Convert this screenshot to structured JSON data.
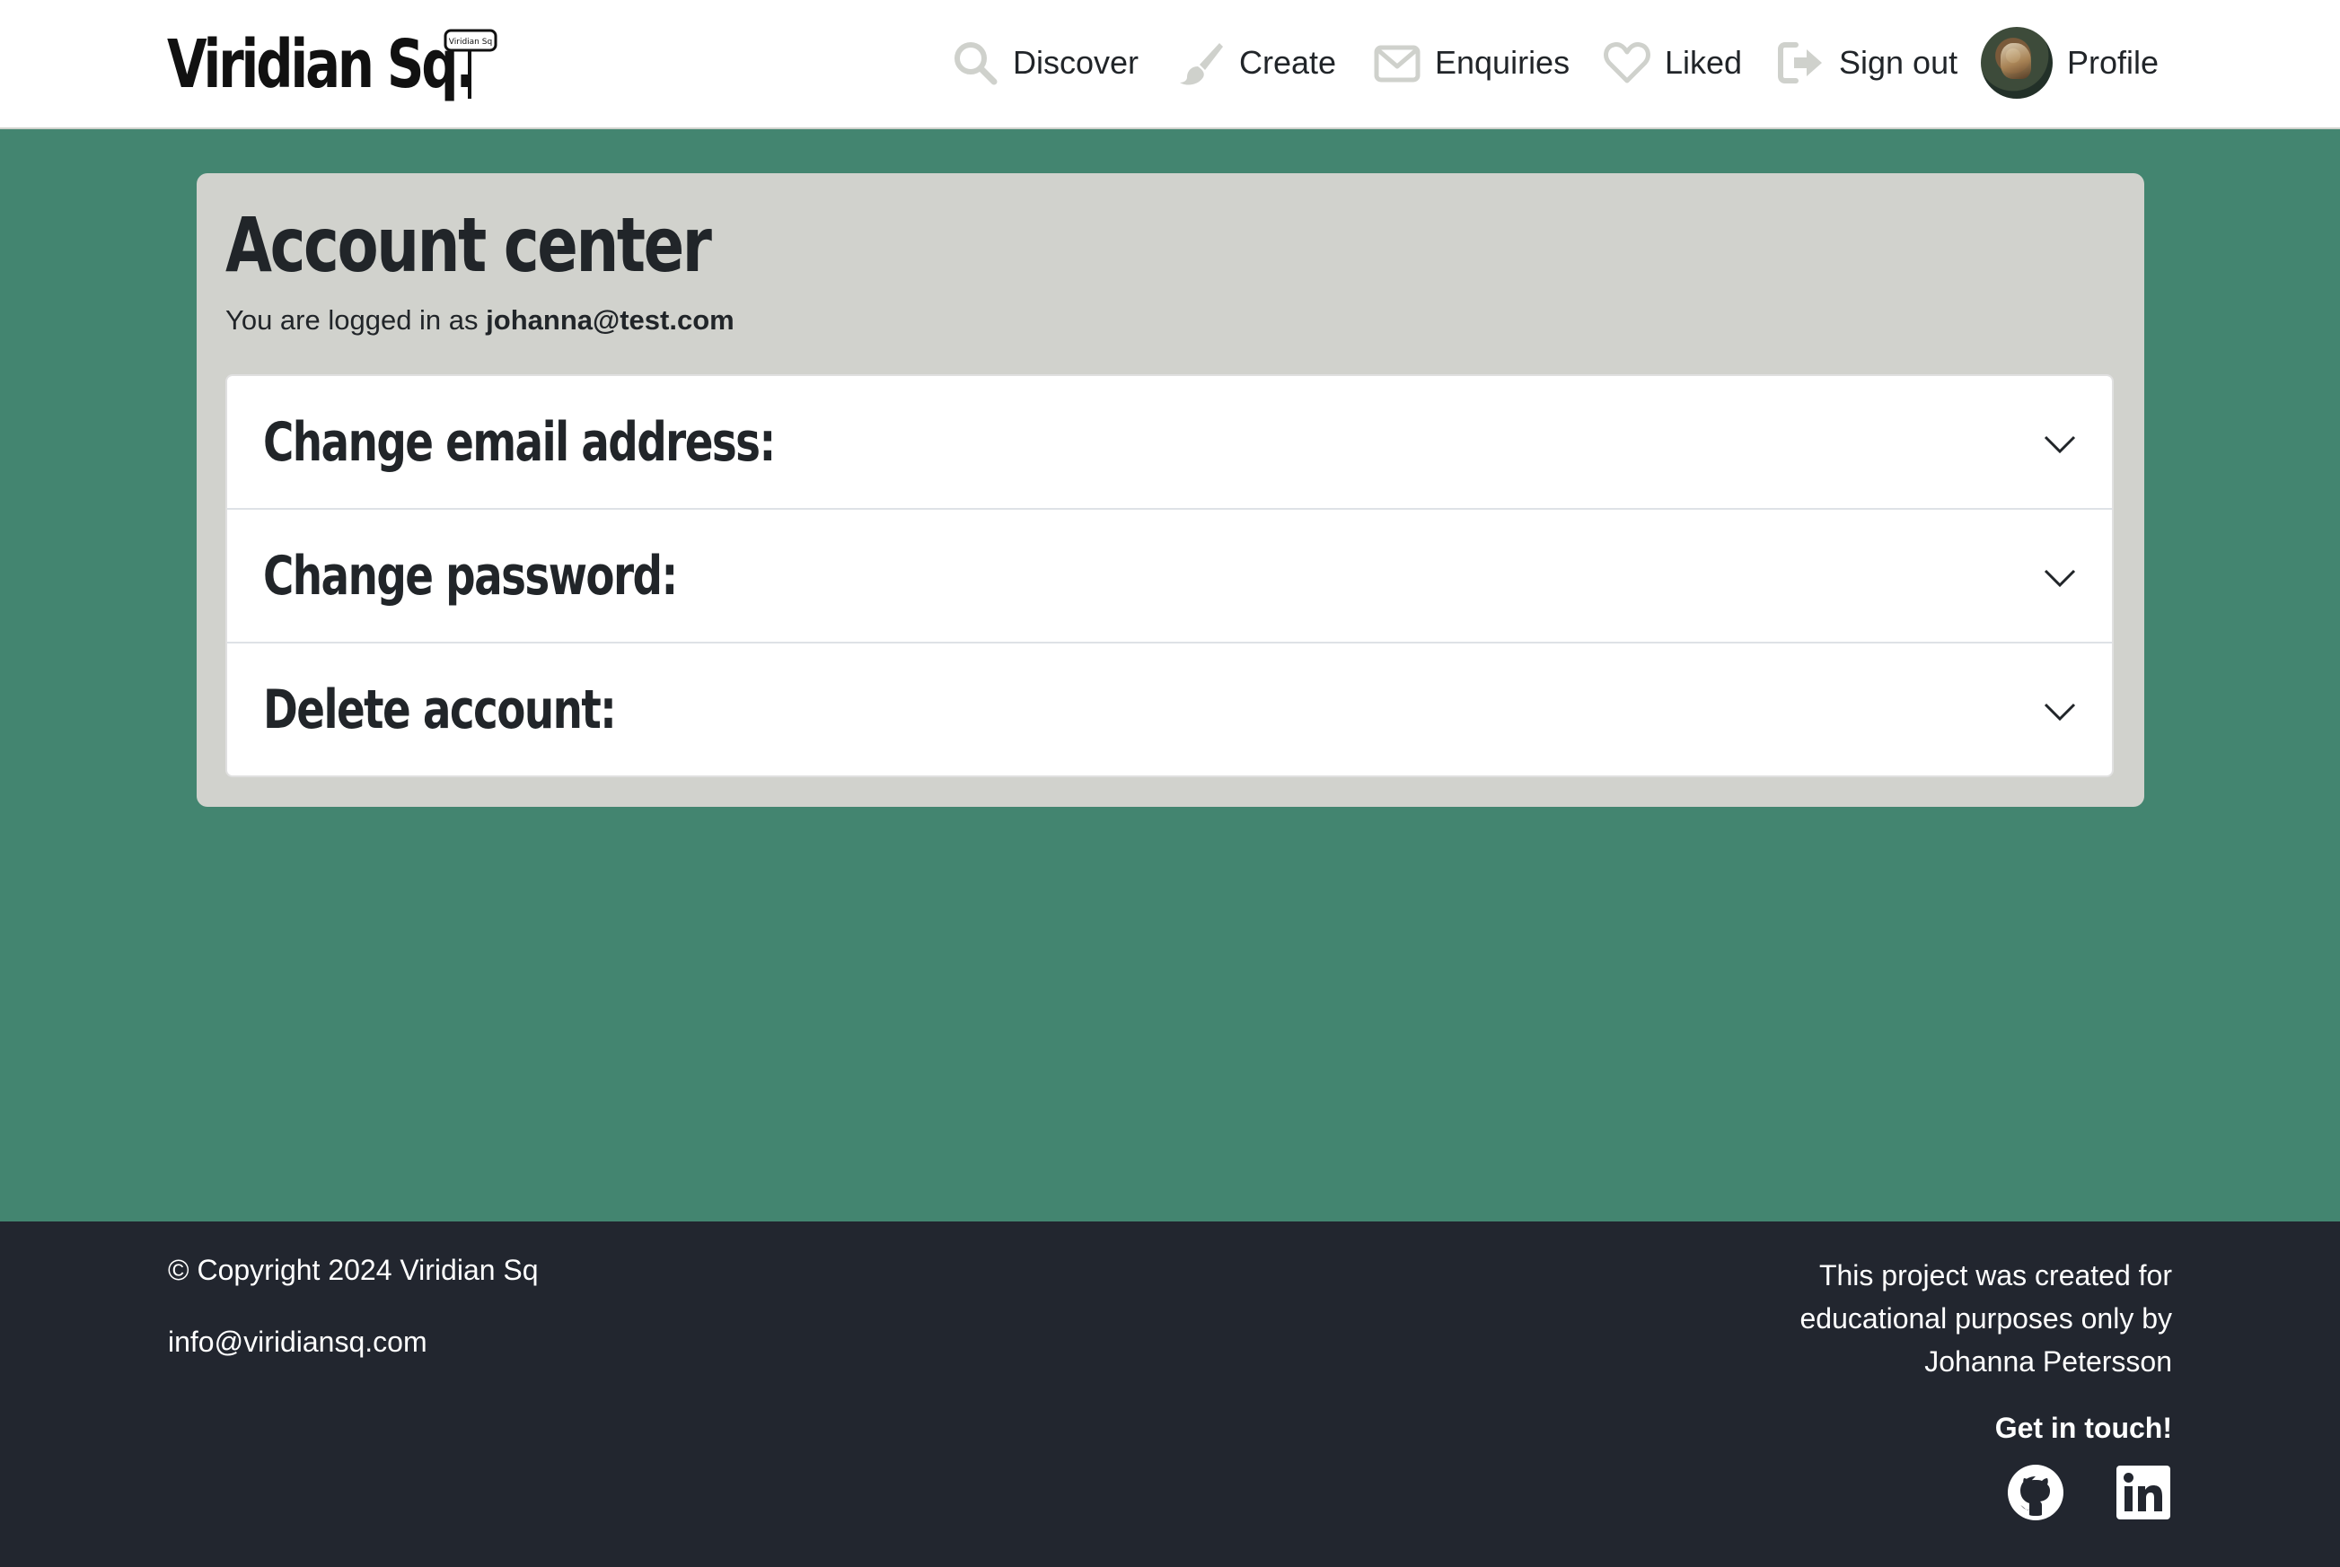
{
  "brand": {
    "name": "Viridian Sq.",
    "sign_text": "Viridian Sq"
  },
  "nav": {
    "discover": "Discover",
    "create": "Create",
    "enquiries": "Enquiries",
    "liked": "Liked",
    "sign_out": "Sign out",
    "profile": "Profile"
  },
  "account": {
    "title": "Account center",
    "logged_in_prefix": "You are logged in as",
    "email": "johanna@test.com",
    "sections": [
      {
        "label": "Change email address:"
      },
      {
        "label": "Change password:"
      },
      {
        "label": "Delete account:"
      }
    ]
  },
  "footer": {
    "copyright": "© Copyright 2024 Viridian Sq",
    "email": "info@viridiansq.com",
    "note_line1": "This project was created for",
    "note_line2": "educational purposes only by",
    "note_line3": "Johanna Petersson",
    "get_in_touch": "Get in touch!",
    "social": [
      "github-icon",
      "linkedin-icon"
    ]
  },
  "colors": {
    "background": "#438570",
    "card": "#d1d2cd",
    "footer": "#22262f",
    "icon_gray": "#cfd1cc"
  }
}
